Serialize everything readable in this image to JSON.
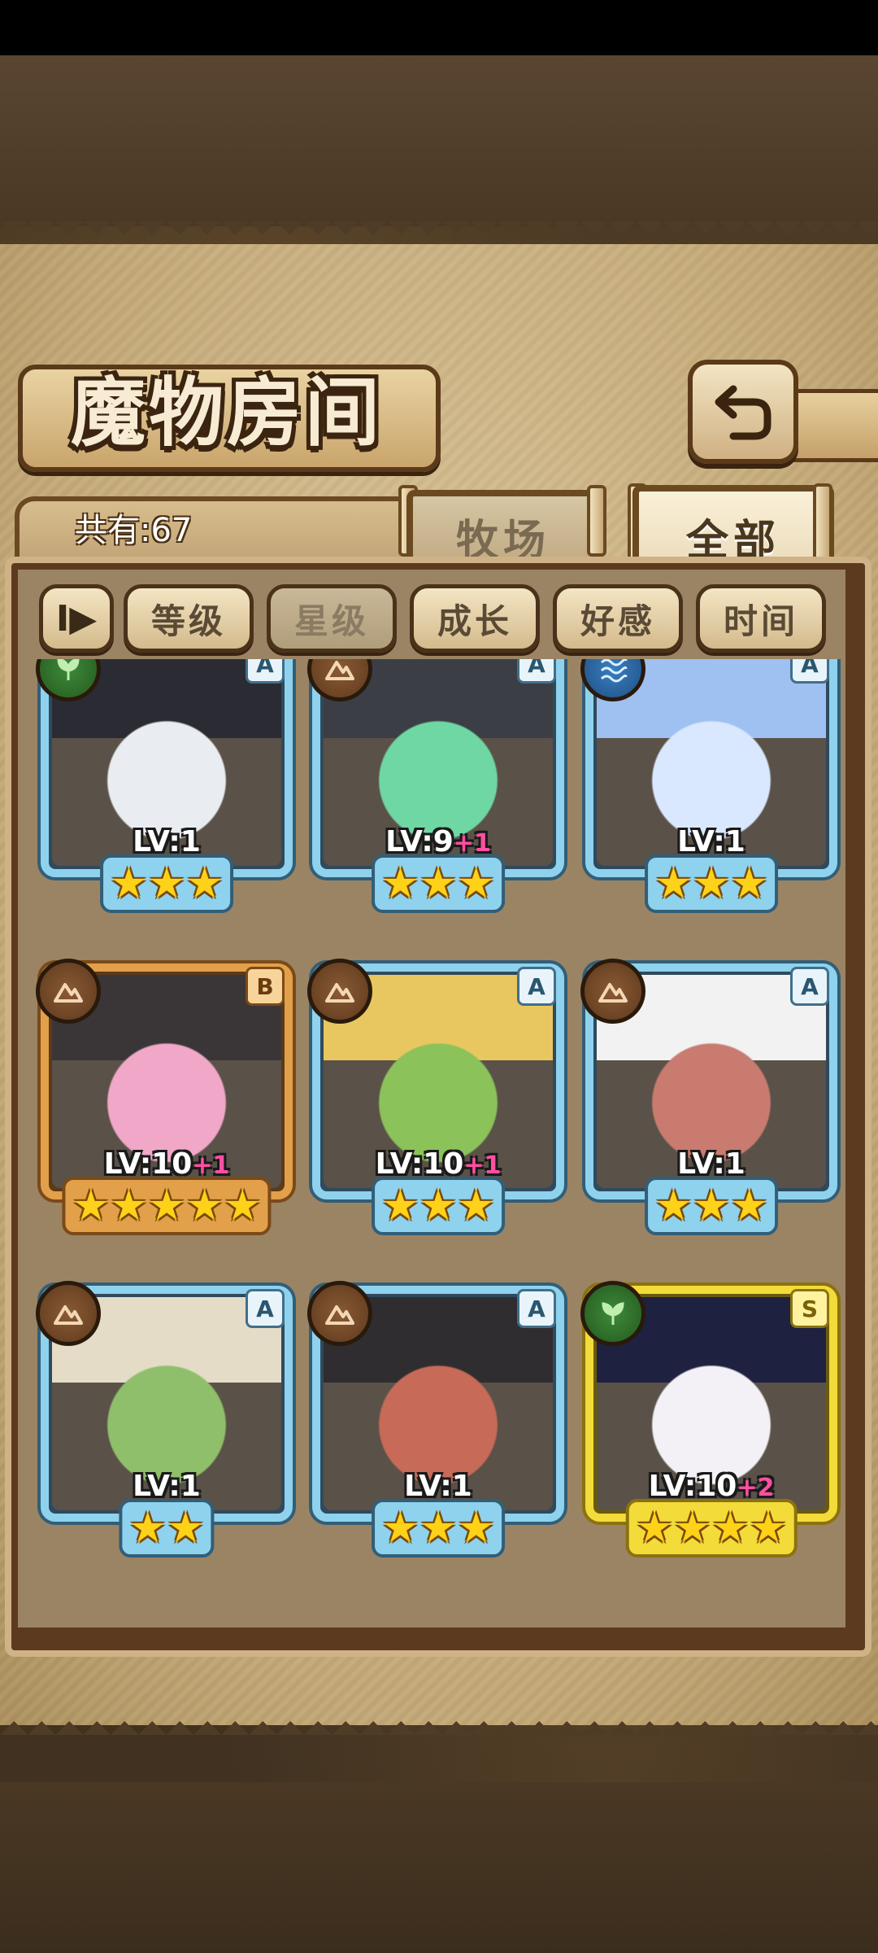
{
  "screen": {
    "title": "魔物房间",
    "count_label": "共有:67"
  },
  "tabs": [
    {
      "label": "牧场",
      "active": false
    },
    {
      "label": "全部",
      "active": true
    }
  ],
  "sort": {
    "toggle_icon": "sort-order-icon",
    "toggle_glyph": "I▶",
    "buttons": [
      {
        "label": "等级",
        "selected": false
      },
      {
        "label": "星级",
        "selected": true
      },
      {
        "label": "成长",
        "selected": false
      },
      {
        "label": "好感",
        "selected": false
      },
      {
        "label": "时间",
        "selected": false
      }
    ]
  },
  "monsters": [
    {
      "rank": "A",
      "element": "nature",
      "level_text": "LV:1",
      "bonus": "",
      "stars": 3,
      "portrait": [
        "#2b2b34",
        "#e9edf2"
      ]
    },
    {
      "rank": "A",
      "element": "earth",
      "level_text": "LV:9",
      "bonus": "+1",
      "stars": 3,
      "portrait": [
        "#3b3f45",
        "#6fd7a4"
      ]
    },
    {
      "rank": "A",
      "element": "water",
      "level_text": "LV:1",
      "bonus": "",
      "stars": 3,
      "portrait": [
        "#9fc1f2",
        "#d9e7ff"
      ]
    },
    {
      "rank": "B",
      "element": "earth",
      "level_text": "LV:10",
      "bonus": "+1",
      "stars": 5,
      "portrait": [
        "#3a3536",
        "#f1a7c7"
      ]
    },
    {
      "rank": "A",
      "element": "earth",
      "level_text": "LV:10",
      "bonus": "+1",
      "stars": 3,
      "portrait": [
        "#e9c760",
        "#8bc25a"
      ]
    },
    {
      "rank": "A",
      "element": "earth",
      "level_text": "LV:1",
      "bonus": "",
      "stars": 3,
      "portrait": [
        "#f2f2f2",
        "#c87b6e"
      ]
    },
    {
      "rank": "A",
      "element": "earth",
      "level_text": "LV:1",
      "bonus": "",
      "stars": 2,
      "portrait": [
        "#e4dcc7",
        "#8fbf6a"
      ]
    },
    {
      "rank": "A",
      "element": "earth",
      "level_text": "LV:1",
      "bonus": "",
      "stars": 3,
      "portrait": [
        "#2f2d2f",
        "#c76a58"
      ]
    },
    {
      "rank": "S",
      "element": "nature",
      "level_text": "LV:10",
      "bonus": "+2",
      "stars": 4,
      "portrait": [
        "#1f2140",
        "#f3f1f6"
      ]
    }
  ],
  "colors": {
    "earth": "#6b4426",
    "nature": "#2f6e2b",
    "water": "#2a64a4",
    "rank_A_frame": "#8fd2ee",
    "rank_B_frame": "#e3a04a",
    "rank_S_frame": "#f3dc3a",
    "star": "#ffd21a",
    "bonus": "#ff4fa0"
  },
  "icons": {
    "back": "back-arrow-icon",
    "star": "star-icon"
  }
}
